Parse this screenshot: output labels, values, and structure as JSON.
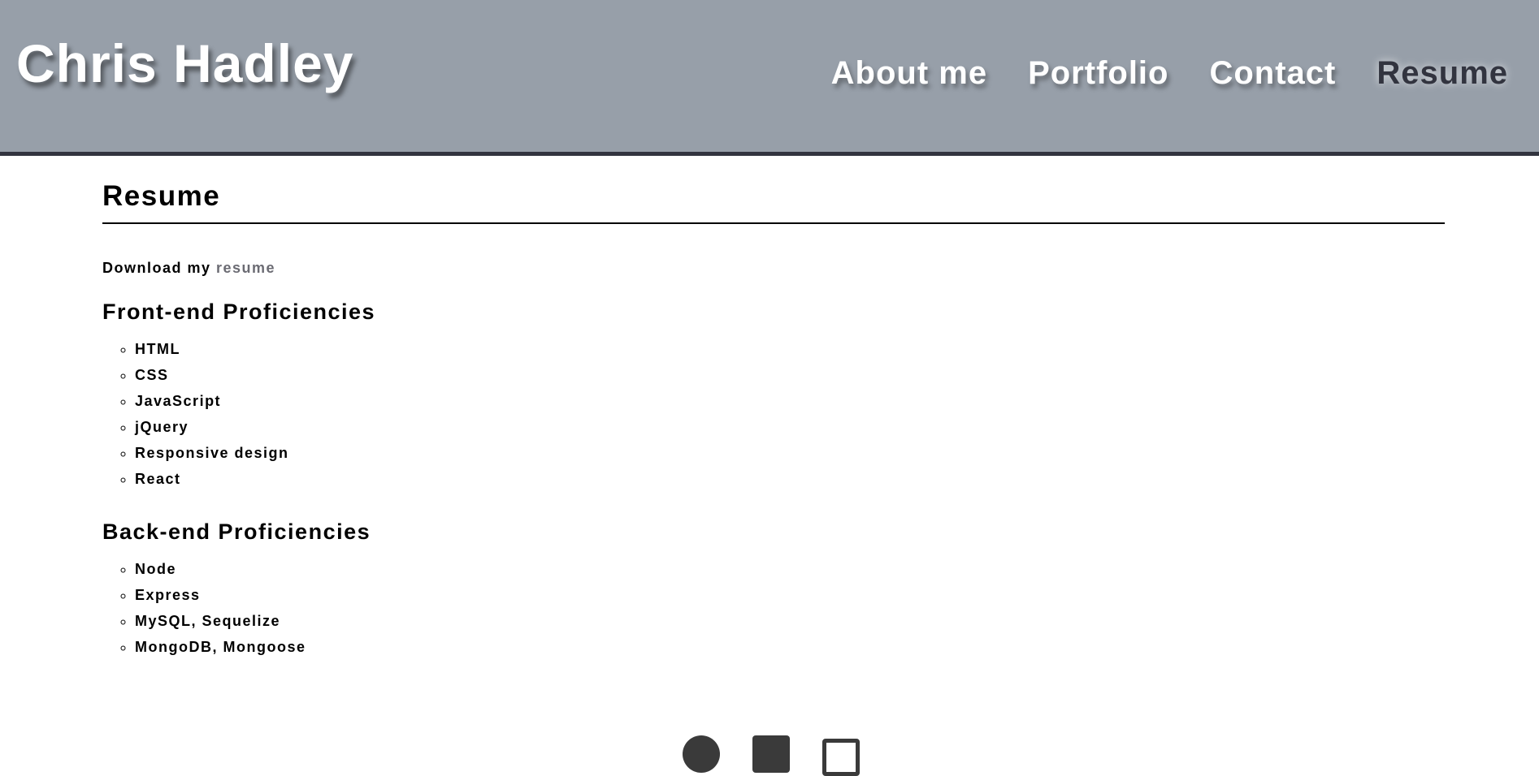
{
  "header": {
    "brand": "Chris Hadley",
    "nav": [
      "About me",
      "Portfolio",
      "Contact",
      "Resume"
    ],
    "active": "Resume"
  },
  "main": {
    "title": "Resume",
    "download_prefix": "Download my ",
    "download_link": "resume",
    "frontend": {
      "heading": "Front-end Proficiencies",
      "items": [
        "HTML",
        "CSS",
        "JavaScript",
        "jQuery",
        "Responsive design",
        "React"
      ]
    },
    "backend": {
      "heading": "Back-end Proficiencies",
      "items": [
        "Node",
        "Express",
        "MySQL, Sequelize",
        "MongoDB, Mongoose"
      ]
    }
  },
  "footer": {
    "icons": [
      "github-icon",
      "linkedin-icon",
      "envelope-icon"
    ]
  }
}
